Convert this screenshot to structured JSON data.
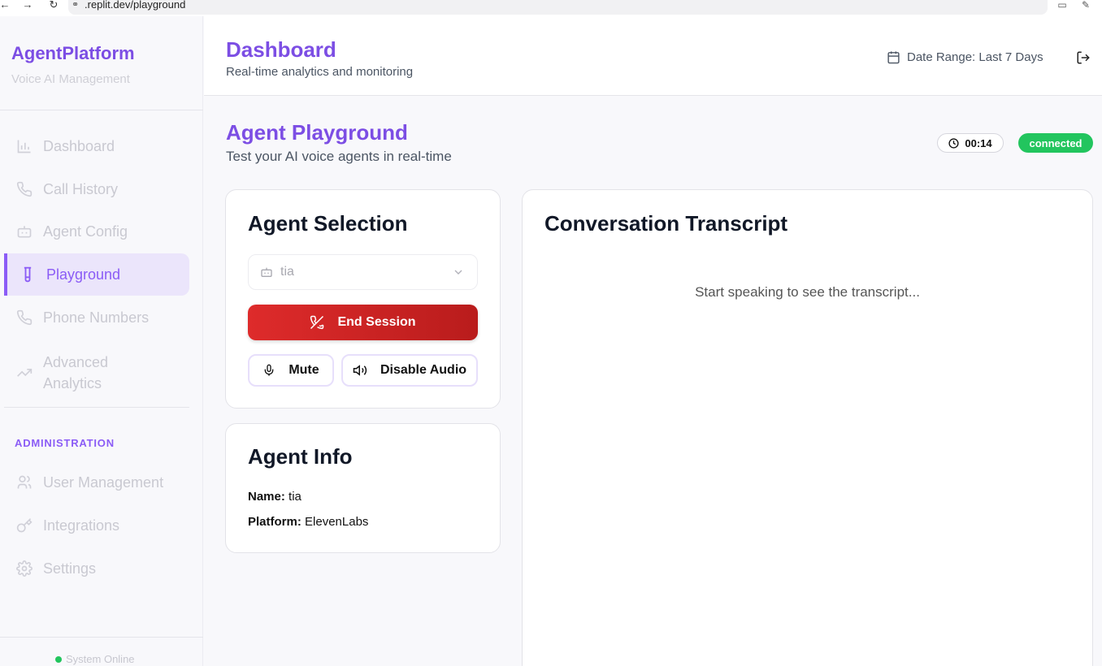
{
  "browser": {
    "url": ".replit.dev/playground"
  },
  "sidebar": {
    "brand": "AgentPlatform",
    "brand_sub": "Voice AI Management",
    "items": [
      {
        "label": "Dashboard",
        "icon": "bar-chart-icon"
      },
      {
        "label": "Call History",
        "icon": "phone-icon"
      },
      {
        "label": "Agent Config",
        "icon": "bot-icon"
      },
      {
        "label": "Playground",
        "icon": "test-tube-icon",
        "active": true
      },
      {
        "label": "Phone Numbers",
        "icon": "phone-icon"
      },
      {
        "label": "Advanced Analytics",
        "icon": "trending-up-icon"
      }
    ],
    "admin_label": "ADMINISTRATION",
    "admin_items": [
      {
        "label": "User Management",
        "icon": "users-icon"
      },
      {
        "label": "Integrations",
        "icon": "key-icon"
      },
      {
        "label": "Settings",
        "icon": "gear-icon"
      }
    ],
    "status": "System Online"
  },
  "header": {
    "title": "Dashboard",
    "subtitle": "Real-time analytics and monitoring",
    "date_range": "Date Range: Last 7 Days"
  },
  "playground": {
    "title": "Agent Playground",
    "subtitle": "Test your AI voice agents in real-time",
    "timer": "00:14",
    "status": "connected"
  },
  "agent_selection": {
    "title": "Agent Selection",
    "selected_agent": "tia",
    "end_session": "End Session",
    "mute": "Mute",
    "disable_audio": "Disable Audio"
  },
  "agent_info": {
    "title": "Agent Info",
    "name_label": "Name:",
    "name_value": "tia",
    "platform_label": "Platform:",
    "platform_value": "ElevenLabs"
  },
  "transcript": {
    "title": "Conversation Transcript",
    "empty": "Start speaking to see the transcript..."
  },
  "colors": {
    "accent": "#7c4ee4",
    "danger": "#dc2626",
    "success": "#22c55e"
  }
}
